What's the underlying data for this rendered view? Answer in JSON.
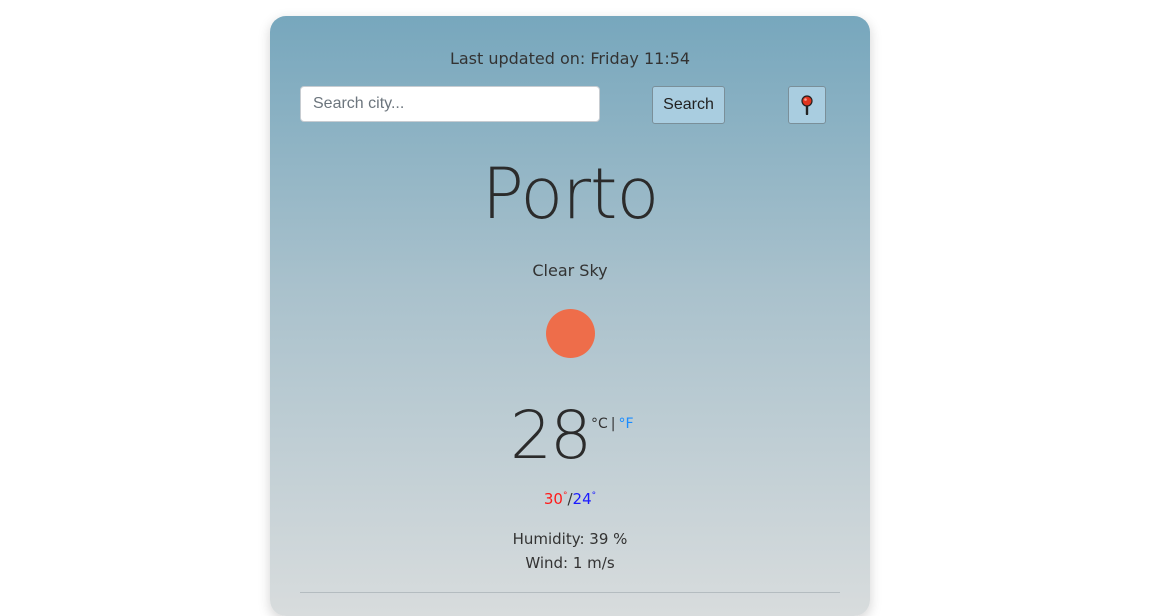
{
  "header": {
    "last_updated": "Last updated on: Friday 11:54"
  },
  "search": {
    "placeholder": "Search city...",
    "value": "",
    "button_label": "Search",
    "location_icon": "pin-icon"
  },
  "weather": {
    "city": "Porto",
    "condition": "Clear Sky",
    "icon": "sun-icon",
    "temperature": "28",
    "unit_celsius": "°C",
    "unit_separator": "|",
    "unit_fahrenheit": "°F",
    "max_temp": "30",
    "min_temp": "24",
    "degree_symbol": "°",
    "minmax_separator": "/",
    "humidity": "Humidity: 39 %",
    "wind": "Wind: 1 m/s"
  },
  "colors": {
    "sun": "#ee6d4a",
    "max_temp": "#ff1a1a",
    "min_temp": "#1a1aff",
    "fahrenheit_link": "#1a8cff",
    "button_bg": "#a9cde0"
  }
}
